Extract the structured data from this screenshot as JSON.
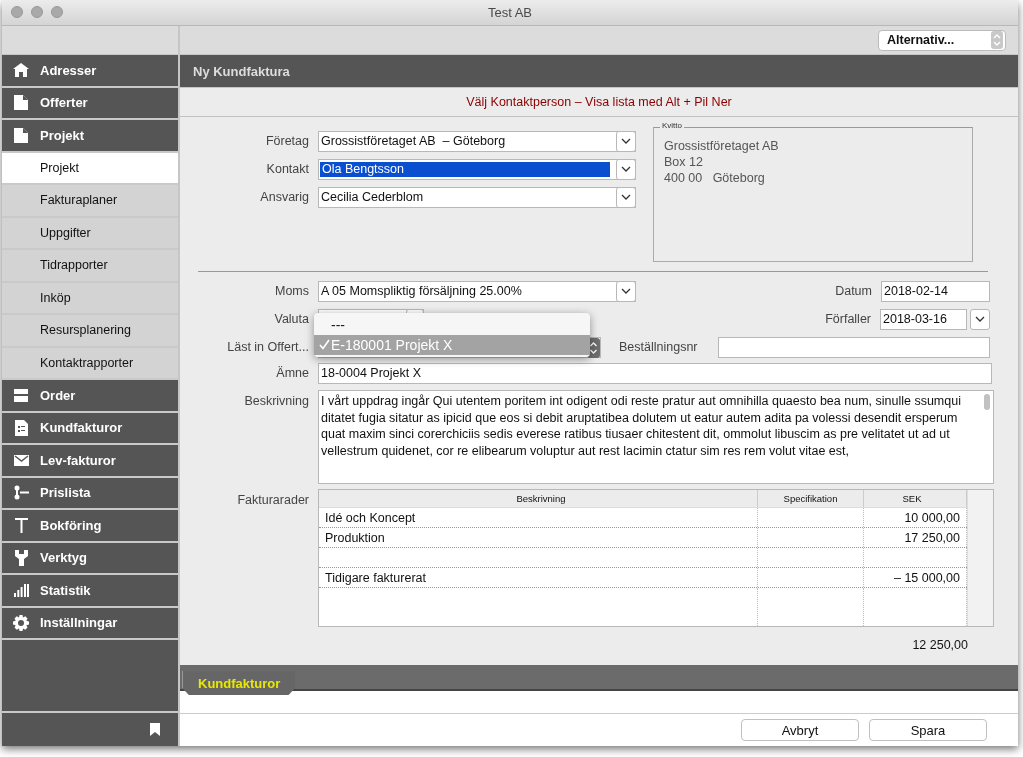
{
  "window": {
    "title": "Test AB"
  },
  "toolbar": {
    "menu": "Alternativ..."
  },
  "sidebar": {
    "items": [
      {
        "label": "Adresser",
        "kind": "section",
        "selected": false
      },
      {
        "label": "Offerter",
        "kind": "section",
        "selected": false
      },
      {
        "label": "Projekt",
        "kind": "section",
        "selected": false
      },
      {
        "label": "Projekt",
        "kind": "sub",
        "selected": true
      },
      {
        "label": "Fakturaplaner",
        "kind": "sub",
        "selected": false
      },
      {
        "label": "Uppgifter",
        "kind": "sub",
        "selected": false
      },
      {
        "label": "Tidrapporter",
        "kind": "sub",
        "selected": false
      },
      {
        "label": "Inköp",
        "kind": "sub",
        "selected": false
      },
      {
        "label": "Resursplanering",
        "kind": "sub",
        "selected": false
      },
      {
        "label": "Kontaktrapporter",
        "kind": "sub",
        "selected": false
      },
      {
        "label": "Order",
        "kind": "section",
        "selected": false
      },
      {
        "label": "Kundfakturor",
        "kind": "section",
        "selected": false
      },
      {
        "label": "Lev-fakturor",
        "kind": "section",
        "selected": false
      },
      {
        "label": "Prislista",
        "kind": "section",
        "selected": false
      },
      {
        "label": "Bokföring",
        "kind": "section",
        "selected": false
      },
      {
        "label": "Verktyg",
        "kind": "section",
        "selected": false
      },
      {
        "label": "Statistik",
        "kind": "section",
        "selected": false
      },
      {
        "label": "Inställningar",
        "kind": "section",
        "selected": false
      }
    ]
  },
  "header": {
    "title": "Ny Kundfaktura"
  },
  "notice": "Välj Kontaktperson – Visa lista med Alt + Pil Ner",
  "parties": [
    {
      "label": "Företag",
      "value": "Grossistföretaget AB  – Göteborg",
      "highlighted": false
    },
    {
      "label": "Kontakt",
      "value": "Ola Bengtsson",
      "highlighted": true
    },
    {
      "label": "Ansvarig",
      "value": "Cecilia Cederblom",
      "highlighted": false
    }
  ],
  "receipt": {
    "title": "Kvitto",
    "lines": [
      "Grossistföretaget AB",
      "Box 12",
      "400 00   Göteborg"
    ]
  },
  "moms": {
    "label": "Moms",
    "value": "A 05 Momspliktig försäljning 25.00%"
  },
  "datum": {
    "label": "Datum",
    "value": "2018-02-14"
  },
  "valuta": {
    "label": "Valuta"
  },
  "forfaller": {
    "label": "Förfaller",
    "value": "2018-03-16"
  },
  "offert": {
    "label": "Läst in Offert...",
    "open": true,
    "options": [
      {
        "label": "---",
        "selected": false
      },
      {
        "label": "E-180001 Projekt X",
        "selected": true
      }
    ]
  },
  "bestallningsnr": {
    "label": "Beställningsnr"
  },
  "amne": {
    "label": "Ämne",
    "value": "18-0004 Projekt X"
  },
  "beskrivning": {
    "label": "Beskrivning",
    "value": "I vårt uppdrag ingår Qui utentem poritem int odigent odi reste pratur aut omnihilla quaesto bea num, sinulle ssumqui ditatet fugia sitatur as ipicid que eos si debit aruptatibea dolutem ut eatur autem adita pa volessi desendit ersperum quat maxim sinci corerchiciis sedis everese ratibus tiusaer chitestent dit, ommolut libuscim as pre velitatet ut ad ut vellestrum quidenet, cor re elibearum voluptur aut rest lacimin ctatur sim res rem volut vitae est,"
  },
  "table": {
    "label": "Fakturarader",
    "columns": [
      "Beskrivning",
      "Specifikation",
      "SEK"
    ],
    "rows": [
      [
        "Idé och Koncept",
        "",
        "10 000,00"
      ],
      [
        "Produktion",
        "",
        "17 250,00"
      ],
      [
        "",
        "",
        ""
      ],
      [
        "Tidigare fakturerat",
        "",
        "– 15 000,00"
      ]
    ]
  },
  "total": "12 250,00",
  "tabs": [
    {
      "label": "Kundfakturor",
      "selected": true
    }
  ],
  "buttons": [
    "Avbryt",
    "Spara"
  ]
}
